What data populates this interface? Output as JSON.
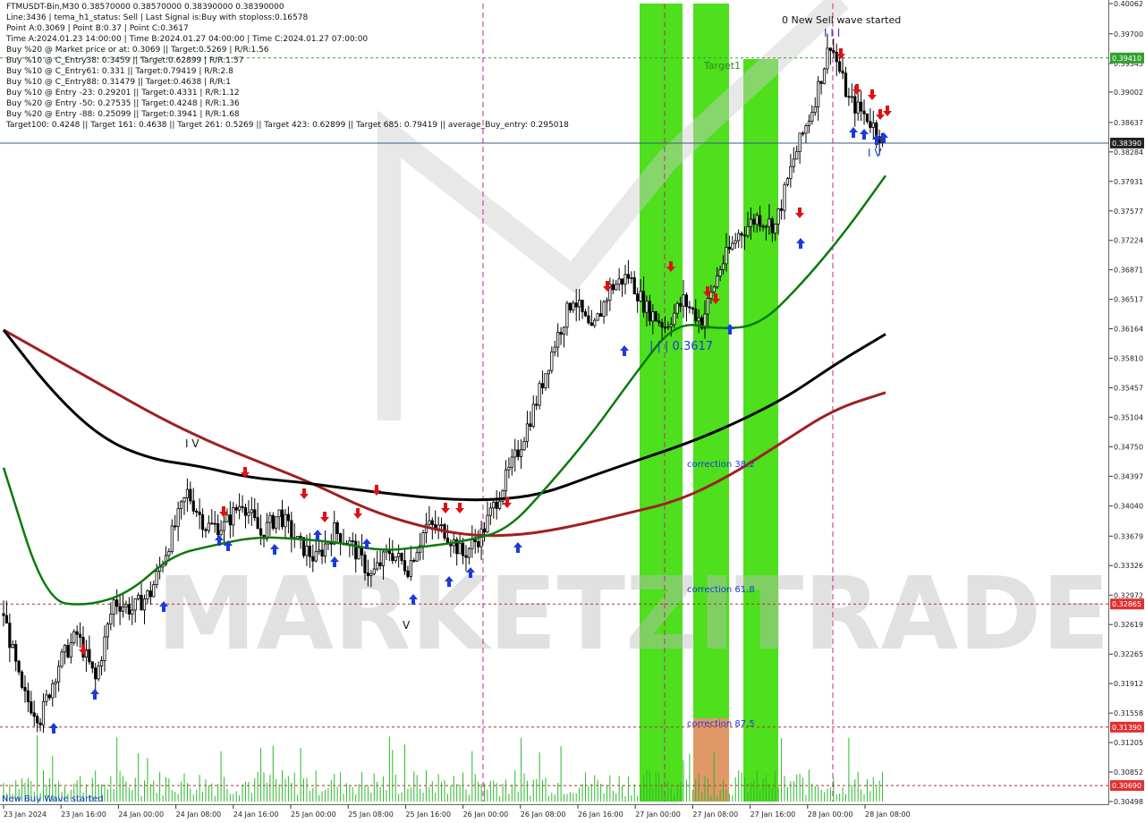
{
  "header": {
    "lines": [
      "FTMUSDT-Bin,M30  0.38570000 0.38570000 0.38390000 0.38390000",
      "Line:3436 | tema_h1_status: Sell | Last Signal is:Buy with stoploss:0.16578",
      "Point A:0.3069 | Point B:0.37 | Point C:0.3617",
      "Time A:2024.01.23 14:00:00 | Time B:2024.01.27 04:00:00 | Time C:2024.01.27 07:00:00",
      "Buy %20 @ Market price or at: 0.3069 || Target:0.5269 | R/R:1.56",
      "Buy %10 @ C_Entry38: 0.3459 || Target:0.62899 | R/R:1.57",
      "Buy %10 @ C_Entry61: 0.331 || Target:0.79419 | R/R:2.8",
      "Buy %10 @ C_Entry88: 0.31479 || Target:0.4638 | R/R:1",
      "Buy %10 @ Entry -23: 0.29201 || Target:0.4331 | R/R:1.12",
      "Buy %20 @ Entry -50: 0.27535 || Target:0.4248 | R/R:1.36",
      "Buy %20 @ Entry -88: 0.25099 || Target:0.3941 | R/R:1.68",
      "Target100: 0.4248 || Target 161: 0.4638 || Target 261: 0.5269 || Target 423: 0.62899 || Target 685: 0.79419 || average_Buy_entry: 0.295018"
    ]
  },
  "watermark": "MARKETZITRADE",
  "annotations": {
    "new_sell_wave": "0 New Sell wave started",
    "new_buy_wave": "New Buy Wave started",
    "target1": "Target1",
    "correction38": "correction 38.2",
    "correction61": "correction 61.8",
    "correction87": "correction 87.5",
    "point_c": "| | | 0.3617",
    "wave_iv": "I V",
    "wave_v": "V",
    "wave_iii": "I I I",
    "wave_iv_right": "I V"
  },
  "colors": {
    "bull_candle": "#000000",
    "green_ma": "#0a7a0a",
    "black_ma": "#000000",
    "red_ma": "#a02020",
    "zone_green": "#44dd11",
    "zone_orange": "#e8956a",
    "buy_arrow": "#1a3adc",
    "sell_arrow": "#e01010",
    "price_badge": "#e03030",
    "target_badge": "#30a030",
    "current_badge": "#222222"
  },
  "chart_data": {
    "type": "candlestick",
    "title": "FTMUSDT-Bin,M30",
    "y_ticks": [
      "0.40062",
      "0.39700",
      "0.39345",
      "0.39002",
      "0.38637",
      "0.38284",
      "0.37931",
      "0.37577",
      "0.37224",
      "0.36871",
      "0.36517",
      "0.36164",
      "0.35810",
      "0.35457",
      "0.35104",
      "0.34750",
      "0.34397",
      "0.34040",
      "0.33679",
      "0.33326",
      "0.32972",
      "0.32619",
      "0.32265",
      "0.31912",
      "0.31558",
      "0.31205",
      "0.30852",
      "0.30498"
    ],
    "x_ticks": [
      "23 Jan 2024",
      "23 Jan 16:00",
      "24 Jan 00:00",
      "24 Jan 08:00",
      "24 Jan 16:00",
      "25 Jan 00:00",
      "25 Jan 08:00",
      "25 Jan 16:00",
      "26 Jan 00:00",
      "26 Jan 08:00",
      "26 Jan 16:00",
      "27 Jan 00:00",
      "27 Jan 08:00",
      "27 Jan 16:00",
      "28 Jan 00:00",
      "28 Jan 08:00"
    ],
    "ylim": [
      0.30498,
      0.40062
    ],
    "levels": [
      {
        "label": "0.39410",
        "value": 0.3941,
        "kind": "target"
      },
      {
        "label": "0.38390",
        "value": 0.3839,
        "kind": "current"
      },
      {
        "label": "0.32865",
        "value": 0.32865,
        "kind": "price"
      },
      {
        "label": "0.31390",
        "value": 0.3139,
        "kind": "price"
      },
      {
        "label": "0.30690",
        "value": 0.3069,
        "kind": "price"
      }
    ],
    "close_path": [
      [
        0,
        0.3275
      ],
      [
        6,
        0.318
      ],
      [
        12,
        0.315
      ],
      [
        18,
        0.3215
      ],
      [
        24,
        0.325
      ],
      [
        30,
        0.3195
      ],
      [
        36,
        0.329
      ],
      [
        42,
        0.328
      ],
      [
        48,
        0.33
      ],
      [
        54,
        0.336
      ],
      [
        60,
        0.342
      ],
      [
        66,
        0.338
      ],
      [
        72,
        0.338
      ],
      [
        78,
        0.341
      ],
      [
        84,
        0.337
      ],
      [
        90,
        0.3395
      ],
      [
        96,
        0.336
      ],
      [
        102,
        0.334
      ],
      [
        108,
        0.3375
      ],
      [
        114,
        0.3355
      ],
      [
        120,
        0.332
      ],
      [
        126,
        0.335
      ],
      [
        132,
        0.333
      ],
      [
        138,
        0.338
      ],
      [
        144,
        0.3375
      ],
      [
        150,
        0.3345
      ],
      [
        156,
        0.337
      ],
      [
        162,
        0.342
      ],
      [
        168,
        0.347
      ],
      [
        174,
        0.353
      ],
      [
        180,
        0.36
      ],
      [
        186,
        0.3655
      ],
      [
        192,
        0.361
      ],
      [
        198,
        0.3665
      ],
      [
        204,
        0.368
      ],
      [
        210,
        0.364
      ],
      [
        216,
        0.362
      ],
      [
        222,
        0.365
      ],
      [
        228,
        0.3625
      ],
      [
        234,
        0.369
      ],
      [
        240,
        0.373
      ],
      [
        246,
        0.375
      ],
      [
        252,
        0.374
      ],
      [
        258,
        0.382
      ],
      [
        264,
        0.388
      ],
      [
        270,
        0.396
      ],
      [
        276,
        0.389
      ],
      [
        282,
        0.387
      ],
      [
        288,
        0.3839
      ]
    ],
    "ma_green": [
      0.345,
      0.329,
      0.3284,
      0.33,
      0.3345,
      0.3357,
      0.3367,
      0.3365,
      0.336,
      0.335,
      0.3355,
      0.3362,
      0.3375,
      0.343,
      0.349,
      0.356,
      0.3625,
      0.3616,
      0.362,
      0.367,
      0.373,
      0.38
    ],
    "ma_black": [
      0.3615,
      0.354,
      0.3485,
      0.346,
      0.3452,
      0.3438,
      0.3433,
      0.3425,
      0.3418,
      0.3412,
      0.3411,
      0.3418,
      0.344,
      0.346,
      0.348,
      0.3505,
      0.3535,
      0.3575,
      0.361
    ],
    "ma_red": [
      0.3615,
      0.358,
      0.3545,
      0.351,
      0.348,
      0.3455,
      0.343,
      0.34,
      0.338,
      0.3368,
      0.3369,
      0.338,
      0.3395,
      0.341,
      0.344,
      0.348,
      0.352,
      0.354
    ]
  }
}
